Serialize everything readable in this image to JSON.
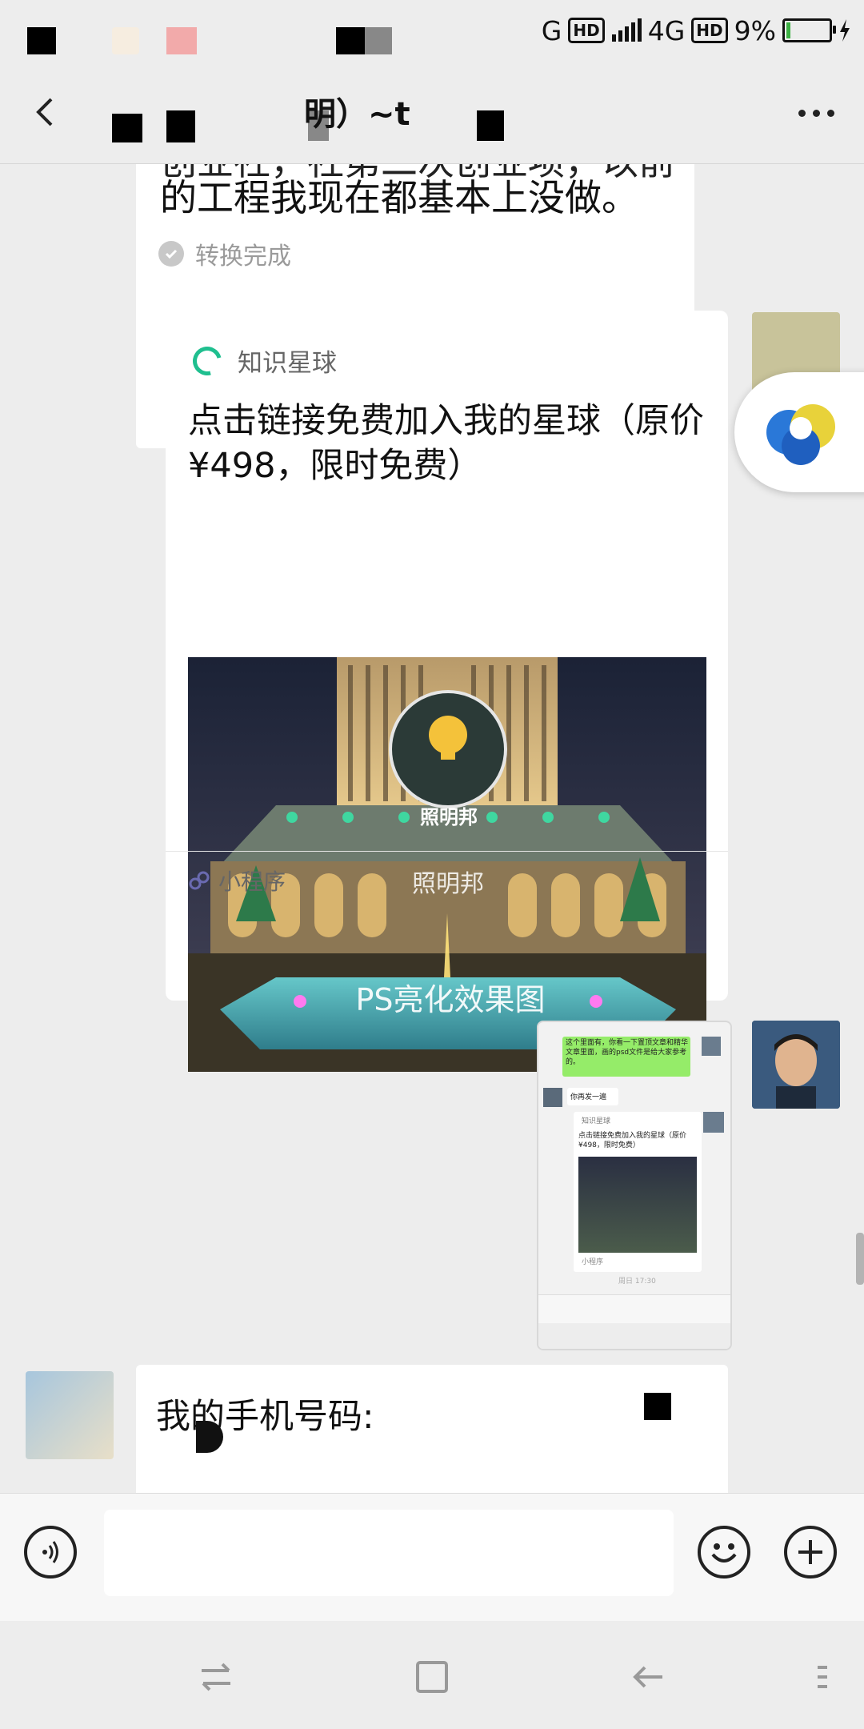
{
  "status_bar": {
    "network1": "G",
    "hd1": "HD",
    "network2": "4G",
    "hd2": "HD",
    "battery_text": "9%",
    "battery_level": 0.09
  },
  "header": {
    "title": "明）~t",
    "back_icon": "back-arrow-icon",
    "more_icon": "more-dots-icon"
  },
  "messages": {
    "prev_text_line1": "创业社，社第二次创业项，以前",
    "prev_text_line2": "的工程我现在都基本上没做。",
    "convert_label": "转换完成",
    "card": {
      "brand": "知识星球",
      "title": "点击链接免费加入我的星球（原价¥498，限时免费）",
      "image_logo_text": "照明邦",
      "image_watermark": "照明邦",
      "image_caption": "PS亮化效果图",
      "footer_label": "小程序"
    },
    "screenshot": {
      "bubble1": "这个里面有，你看一下置顶文章和精华文章里面，画的psd文件是给大家参考的。",
      "bubble2": "你再发一遍",
      "card_brand": "知识星球",
      "card_title": "点击链接免费加入我的星球（原价¥498，限时免费）",
      "card_footer": "小程序",
      "time": "周日 17:30"
    },
    "phone_text": "我的手机号码:"
  },
  "input_bar": {
    "voice_icon": "voice-icon",
    "emoji_icon": "emoji-icon",
    "plus_icon": "plus-icon"
  },
  "nav_bar": {
    "icons": [
      "switch-icon",
      "home-square-icon",
      "back-icon",
      "menu-icon"
    ]
  }
}
